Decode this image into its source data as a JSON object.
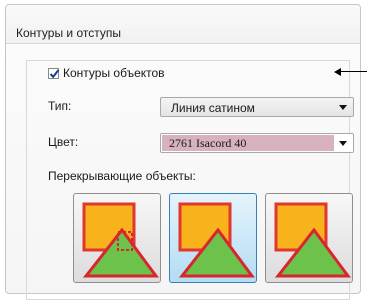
{
  "panel": {
    "title": "Контуры и отступы"
  },
  "outline": {
    "checkbox_label": "Контуры объектов",
    "checked": true
  },
  "type_field": {
    "label": "Тип:",
    "value": "Линия сатином"
  },
  "color_field": {
    "label": "Цвет:",
    "value": "2761 Isacord 40",
    "swatch_color": "#d7b2bd"
  },
  "overlap": {
    "label": "Перекрывающие объекты:",
    "options": [
      {
        "name": "overlap-outline-both",
        "selected": false
      },
      {
        "name": "overlap-outline-top",
        "selected": true
      },
      {
        "name": "overlap-outline-separate",
        "selected": false
      }
    ]
  },
  "colors": {
    "square_fill": "#f7b21c",
    "square_border": "#e2372e",
    "triangle_fill": "#6cc24a",
    "triangle_border": "#d8262e",
    "selected_bg": "#b3dcf3"
  }
}
